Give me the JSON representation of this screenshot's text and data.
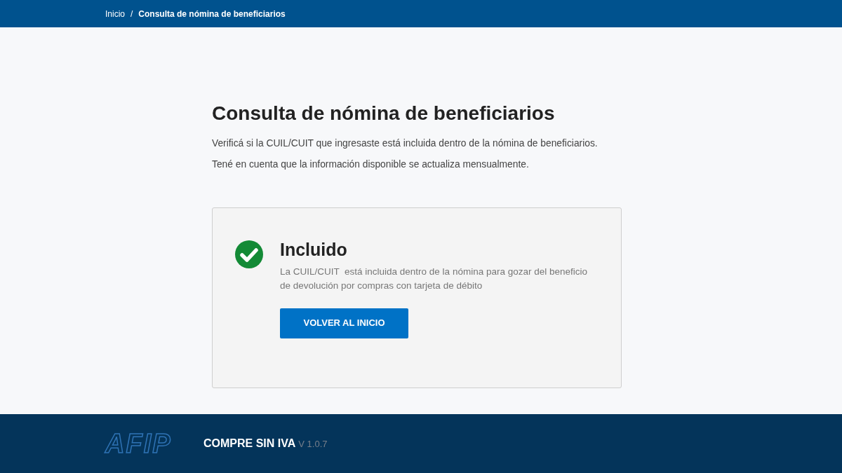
{
  "breadcrumb": [
    {
      "label": "Inicio",
      "current": false
    },
    {
      "label": "Consulta de nómina de beneficiarios",
      "current": true
    }
  ],
  "separator": "/",
  "title": "Consulta de nómina de beneficiarios",
  "intro": [
    "Verificá si la CUIL/CUIT que ingresaste está incluida dentro de la nómina de beneficiarios.",
    "Tené en cuenta que la información disponible se actualiza mensualmente."
  ],
  "result": {
    "included": true,
    "title": "Incluido",
    "message": "La CUIL/CUIT  está incluida dentro de la nómina para gozar del beneficio de devolución por compras con tarjeta de débito",
    "button": "VOLVER AL INICIO"
  },
  "footer": {
    "logo": "AFIP",
    "app_name": "COMPRE SIN IVA",
    "version": "V 1.0.7"
  }
}
